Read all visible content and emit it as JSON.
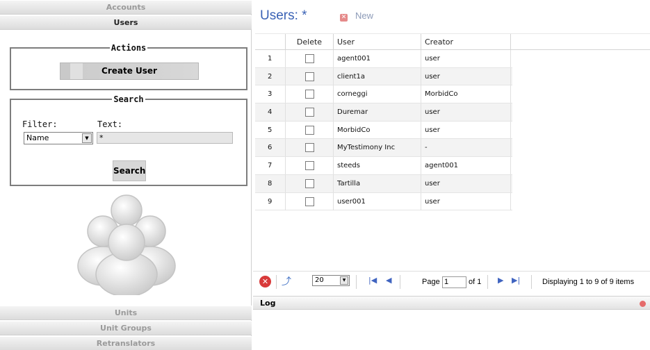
{
  "sidebar": {
    "sections_top": [
      {
        "label": "Accounts",
        "active": false
      },
      {
        "label": "Users",
        "active": true
      }
    ],
    "sections_bottom": [
      {
        "label": "Units"
      },
      {
        "label": "Unit Groups"
      },
      {
        "label": "Retranslators"
      }
    ],
    "actions": {
      "legend": "Actions",
      "create_user_label": "Create User"
    },
    "search": {
      "legend": "Search",
      "filter_label": "Filter:",
      "text_label": "Text:",
      "filter_value": "Name",
      "text_value": "*",
      "search_label": "Search"
    }
  },
  "main": {
    "title": "Users: *",
    "new_label": "New",
    "columns": {
      "delete": "Delete",
      "user": "User",
      "creator": "Creator"
    },
    "rows": [
      {
        "num": "1",
        "user": "agent001",
        "creator": "user"
      },
      {
        "num": "2",
        "user": "client1a",
        "creator": "user"
      },
      {
        "num": "3",
        "user": "corneggi",
        "creator": "MorbidCo"
      },
      {
        "num": "4",
        "user": "Duremar",
        "creator": "user"
      },
      {
        "num": "5",
        "user": "MorbidCo",
        "creator": "user"
      },
      {
        "num": "6",
        "user": "MyTestimony Inc",
        "creator": "-"
      },
      {
        "num": "7",
        "user": "steeds",
        "creator": "agent001"
      },
      {
        "num": "8",
        "user": "Tartilla",
        "creator": "user"
      },
      {
        "num": "9",
        "user": "user001",
        "creator": "user"
      }
    ],
    "pager": {
      "page_size": "20",
      "page_label": "Page",
      "page_value": "1",
      "of_label": "of 1",
      "display_info": "Displaying 1 to 9 of 9 items"
    },
    "log": {
      "title": "Log"
    }
  },
  "colors": {
    "title": "#3a62b5",
    "new_icon": "#e58a8a",
    "delete_icon": "#d83a3a",
    "nav": "#4064c0"
  }
}
